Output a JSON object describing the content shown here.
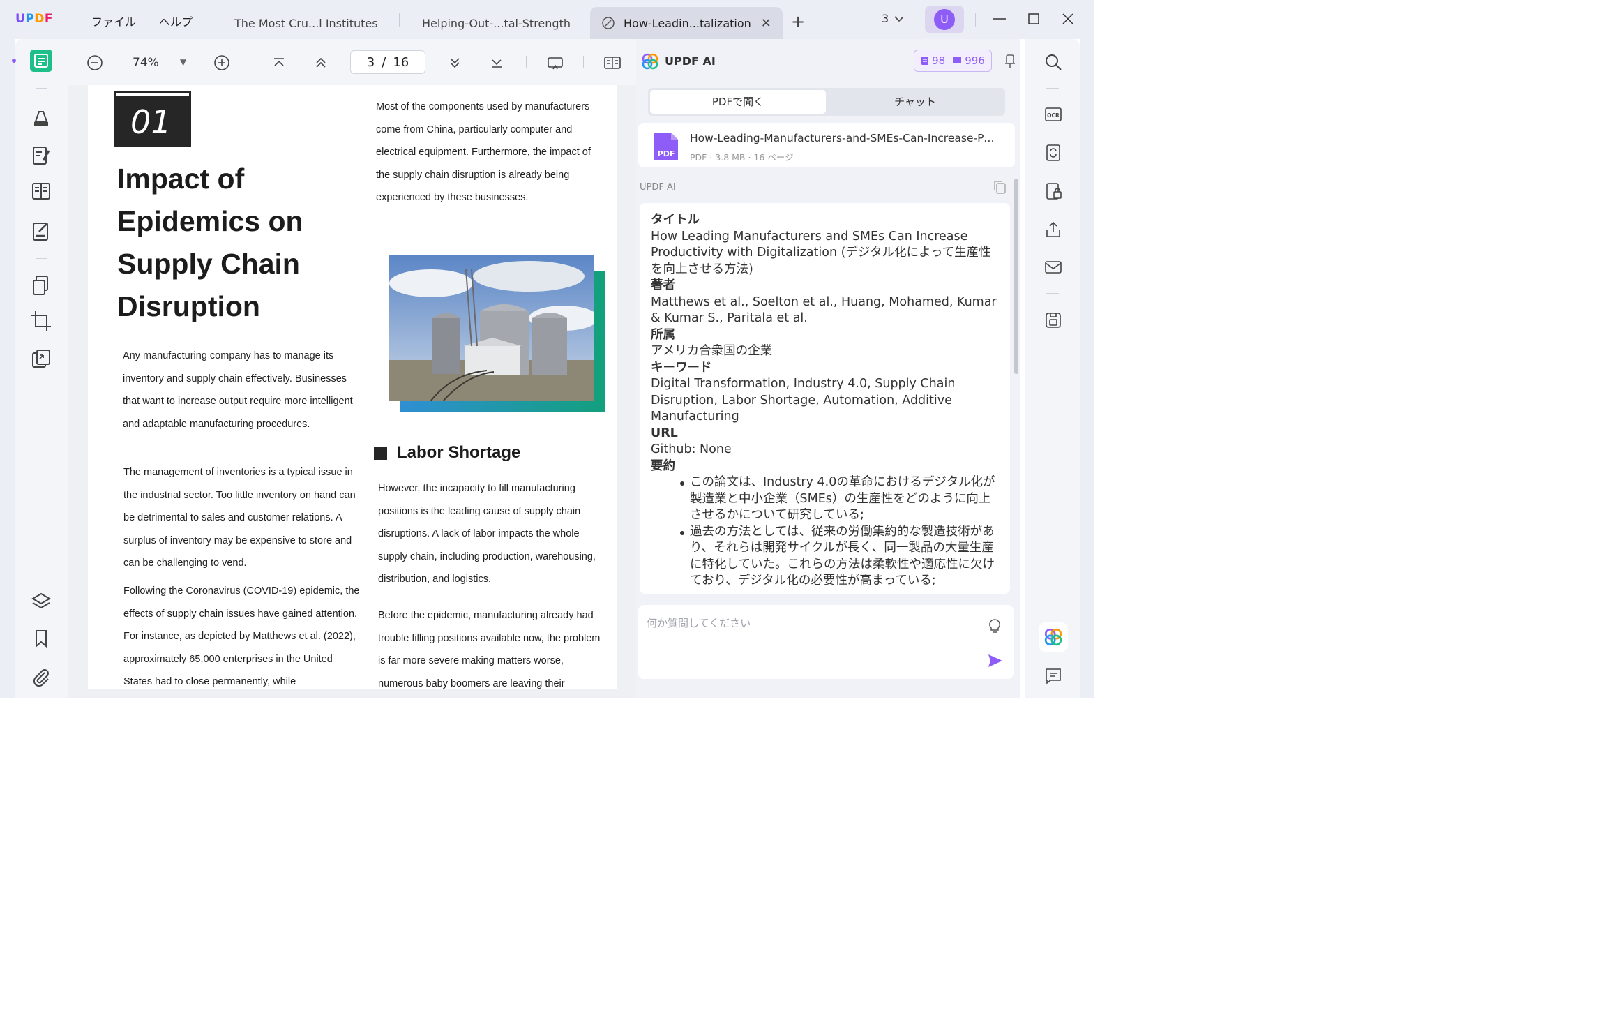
{
  "titlebar": {
    "logo": [
      "U",
      "P",
      "D",
      "F"
    ],
    "menus": [
      "ファイル",
      "ヘルプ"
    ],
    "tabs": [
      "The Most Cru...l Institutes",
      "Helping-Out-...tal-Strength",
      "How-Leadin...talization"
    ],
    "window_count": "3",
    "user_initial": "U"
  },
  "toolbar": {
    "zoom": "74%",
    "page_current": "3",
    "page_separator": "/",
    "page_total": "16"
  },
  "pdf": {
    "badge": "01",
    "title": "Impact of Epidemics on Supply Chain Disruption",
    "left_paragraphs": [
      "Any manufacturing company has to manage its inventory and supply chain effectively. Businesses that want to increase output require more intelligent and adaptable manufacturing procedures.",
      "The management of inventories is a typical issue in the industrial sector. Too little inventory on hand can be detrimental to sales and customer relations. A surplus of inventory may be expensive to store and can be challenging to vend.",
      "Following the Coronavirus (COVID-19) epidemic, the effects of supply chain issues have gained attention. For instance, as depicted by Matthews et al. (2022), approximately 65,000 enterprises in the United States had to close permanently, while"
    ],
    "right_top_paragraph": "Most of the components used by manufacturers come from China, particularly computer and electrical equipment. Furthermore, the impact of the supply chain disruption is already being experienced by these businesses.",
    "section_heading": "Labor Shortage",
    "right_paragraphs": [
      "However, the incapacity to fill manufacturing positions is the leading cause of supply chain disruptions. A lack of labor impacts the whole supply chain, including production, warehousing, distribution, and logistics.",
      "Before the epidemic, manufacturing already had trouble filling positions available  now, the problem is far more severe  making matters worse, numerous baby boomers are leaving their"
    ]
  },
  "ai": {
    "name": "UPDF AI",
    "quota_docs": "98",
    "quota_chat": "996",
    "tab_ask_pdf": "PDFで聞く",
    "tab_chat": "チャット",
    "file_name": "How-Leading-Manufacturers-and-SMEs-Can-Increase-Pro...",
    "file_meta": "PDF · 3.8 MB · 16 ページ",
    "file_type": "PDF",
    "response_label": "UPDF AI",
    "response": {
      "title_heading": "タイトル",
      "title_text": "How Leading Manufacturers and SMEs Can Increase Productivity with Digitalization (デジタル化によって生産性を向上させる方法)",
      "author_heading": "著者",
      "author_text": "Matthews et al., Soelton et al., Huang, Mohamed, Kumar & Kumar S., Paritala et al.",
      "affil_heading": "所属",
      "affil_text": "アメリカ合衆国の企業",
      "keywords_heading": "キーワード",
      "keywords_text": "Digital Transformation, Industry 4.0, Supply Chain Disruption, Labor Shortage, Automation, Additive Manufacturing",
      "url_heading": "URL",
      "url_text": "Github: None",
      "summary_heading": "要約",
      "bullets": [
        "この論文は、Industry 4.0の革命におけるデジタル化が製造業と中小企業（SMEs）の生産性をどのように向上させるかについて研究している;",
        "過去の方法としては、従来の労働集約的な製造技術があり、それらは開発サイクルが長く、同一製品の大量生産に特化していた。これらの方法は柔軟性や適応性に欠けており、デジタル化の必要性が高まっている;"
      ]
    },
    "input_placeholder": "何か質問してください"
  },
  "colors": {
    "accent": "#8e5cf7",
    "teal": "#12a07d",
    "green_tool": "#1fbf8a"
  }
}
